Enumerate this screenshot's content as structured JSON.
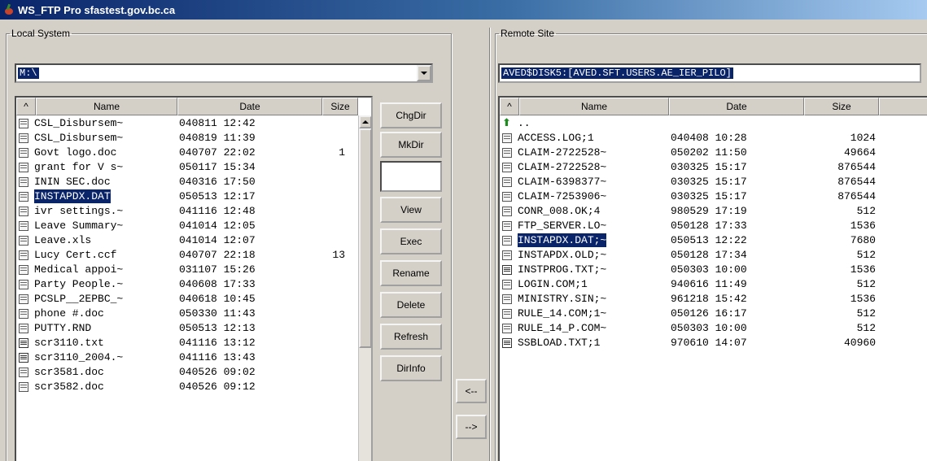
{
  "window": {
    "title": "WS_FTP Pro sfastest.gov.bc.ca"
  },
  "local": {
    "group_label": "Local System",
    "path": "M:\\",
    "columns": {
      "sort": "^",
      "name": "Name",
      "date": "Date",
      "size": "Size"
    },
    "files": [
      {
        "name": "CSL_Disbursem~",
        "date": "040811 12:42",
        "size": "",
        "icon": "doc-icon"
      },
      {
        "name": "CSL_Disbursem~",
        "date": "040819 11:39",
        "size": "",
        "icon": "doc-icon"
      },
      {
        "name": "Govt logo.doc",
        "date": "040707 22:02",
        "size": "1",
        "icon": "doc-icon"
      },
      {
        "name": "grant for V s~",
        "date": "050117 15:34",
        "size": "",
        "icon": "doc-icon"
      },
      {
        "name": "ININ SEC.doc",
        "date": "040316 17:50",
        "size": "",
        "icon": "doc-icon"
      },
      {
        "name": "INSTAPDX.DAT",
        "date": "050513 12:17",
        "size": "",
        "icon": "doc-icon",
        "selected": true
      },
      {
        "name": "ivr settings.~",
        "date": "041116 12:48",
        "size": "",
        "icon": "doc-icon"
      },
      {
        "name": "Leave Summary~",
        "date": "041014 12:05",
        "size": "",
        "icon": "doc-icon"
      },
      {
        "name": "Leave.xls",
        "date": "041014 12:07",
        "size": "",
        "icon": "doc-icon"
      },
      {
        "name": "Lucy Cert.ccf",
        "date": "040707 22:18",
        "size": "13",
        "icon": "doc-icon"
      },
      {
        "name": "Medical appoi~",
        "date": "031107 15:26",
        "size": "",
        "icon": "doc-icon"
      },
      {
        "name": "Party People.~",
        "date": "040608 17:33",
        "size": "",
        "icon": "doc-icon"
      },
      {
        "name": "PCSLP__2EPBC_~",
        "date": "040618 10:45",
        "size": "",
        "icon": "doc-icon"
      },
      {
        "name": "phone #.doc",
        "date": "050330 11:43",
        "size": "",
        "icon": "doc-icon"
      },
      {
        "name": "PUTTY.RND",
        "date": "050513 12:13",
        "size": "",
        "icon": "doc-icon"
      },
      {
        "name": "scr3110.txt",
        "date": "041116 13:12",
        "size": "",
        "icon": "text-file-icon"
      },
      {
        "name": "scr3110_2004.~",
        "date": "041116 13:43",
        "size": "",
        "icon": "text-file-icon"
      },
      {
        "name": "scr3581.doc",
        "date": "040526 09:02",
        "size": "",
        "icon": "doc-icon"
      },
      {
        "name": "scr3582.doc",
        "date": "040526 09:12",
        "size": "",
        "icon": "doc-icon"
      }
    ]
  },
  "buttons": {
    "chgdir": "ChgDir",
    "mkdir": "MkDir",
    "view": "View",
    "exec": "Exec",
    "rename": "Rename",
    "delete": "Delete",
    "refresh": "Refresh",
    "dirinfo": "DirInfo",
    "upload": "<--",
    "download": "-->"
  },
  "remote": {
    "group_label": "Remote Site",
    "path": "AVED$DISK5:[AVED.SFT.USERS.AE_IER_PILO]",
    "columns": {
      "sort": "^",
      "name": "Name",
      "date": "Date",
      "size": "Size"
    },
    "parent_dir": "..",
    "files": [
      {
        "name": "ACCESS.LOG;1",
        "date": "040408 10:28",
        "size": "1024",
        "icon": "doc-icon"
      },
      {
        "name": "CLAIM-2722528~",
        "date": "050202 11:50",
        "size": "49664",
        "icon": "doc-icon"
      },
      {
        "name": "CLAIM-2722528~",
        "date": "030325 15:17",
        "size": "876544",
        "icon": "doc-icon"
      },
      {
        "name": "CLAIM-6398377~",
        "date": "030325 15:17",
        "size": "876544",
        "icon": "doc-icon"
      },
      {
        "name": "CLAIM-7253906~",
        "date": "030325 15:17",
        "size": "876544",
        "icon": "doc-icon"
      },
      {
        "name": "CONR_008.OK;4",
        "date": "980529 17:19",
        "size": "512",
        "icon": "doc-icon"
      },
      {
        "name": "FTP_SERVER.LO~",
        "date": "050128 17:33",
        "size": "1536",
        "icon": "doc-icon"
      },
      {
        "name": "INSTAPDX.DAT;~",
        "date": "050513 12:22",
        "size": "7680",
        "icon": "doc-icon",
        "selected": true
      },
      {
        "name": "INSTAPDX.OLD;~",
        "date": "050128 17:34",
        "size": "512",
        "icon": "doc-icon"
      },
      {
        "name": "INSTPROG.TXT;~",
        "date": "050303 10:00",
        "size": "1536",
        "icon": "text-file-icon"
      },
      {
        "name": "LOGIN.COM;1",
        "date": "940616 11:49",
        "size": "512",
        "icon": "doc-icon"
      },
      {
        "name": "MINISTRY.SIN;~",
        "date": "961218 15:42",
        "size": "1536",
        "icon": "doc-icon"
      },
      {
        "name": "RULE_14.COM;1~",
        "date": "050126 16:17",
        "size": "512",
        "icon": "doc-icon"
      },
      {
        "name": "RULE_14_P.COM~",
        "date": "050303 10:00",
        "size": "512",
        "icon": "doc-icon"
      },
      {
        "name": "SSBLOAD.TXT;1",
        "date": "970610 14:07",
        "size": "40960",
        "icon": "text-file-icon"
      }
    ]
  }
}
